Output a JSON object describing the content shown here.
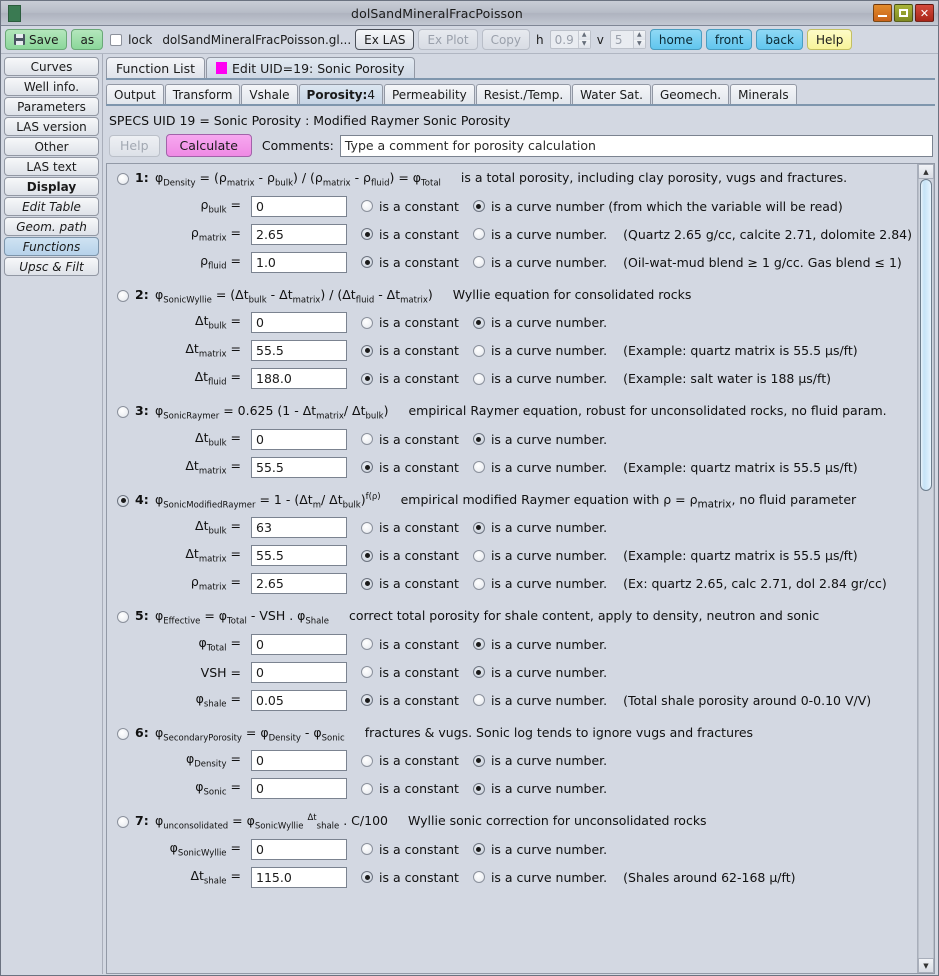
{
  "window": {
    "title": "dolSandMineralFracPoisson",
    "buttons": {
      "minimize": "–",
      "maximize": "□",
      "close": "✕"
    }
  },
  "toolbar": {
    "save_label": "Save",
    "save_as_label": "as",
    "lock_label": "lock",
    "filename": "dolSandMineralFracPoisson.gl...",
    "ex_las_label": "Ex LAS",
    "ex_plot_label": "Ex Plot",
    "copy_label": "Copy",
    "h_label": "h",
    "h_value": "0.9",
    "v_label": "v",
    "v_value": "5",
    "home_label": "home",
    "front_label": "front",
    "back_label": "back",
    "help_label": "Help"
  },
  "sidebar": {
    "items": [
      {
        "label": "Curves",
        "style": "normal",
        "selected": false
      },
      {
        "label": "Well info.",
        "style": "normal",
        "selected": false
      },
      {
        "label": "Parameters",
        "style": "normal",
        "selected": false
      },
      {
        "label": "LAS version",
        "style": "normal",
        "selected": false
      },
      {
        "label": "Other",
        "style": "normal",
        "selected": false
      },
      {
        "label": "LAS text",
        "style": "normal",
        "selected": false
      },
      {
        "label": "Display",
        "style": "bold",
        "selected": false
      },
      {
        "label": "Edit Table",
        "style": "italic",
        "selected": false
      },
      {
        "label": "Geom. path",
        "style": "italic",
        "selected": false
      },
      {
        "label": "Functions",
        "style": "italic",
        "selected": true
      },
      {
        "label": "Upsc & Filt",
        "style": "italic",
        "selected": false
      }
    ]
  },
  "tabs_primary": [
    {
      "label": "Function List",
      "active": false,
      "has_marker": false
    },
    {
      "label": "Edit UID=19: Sonic Porosity",
      "active": true,
      "has_marker": true
    }
  ],
  "tabs_secondary": [
    {
      "label": "Output",
      "suffix": "",
      "active": false
    },
    {
      "label": "Transform",
      "suffix": "",
      "active": false
    },
    {
      "label": "Vshale",
      "suffix": "",
      "active": false
    },
    {
      "label": "Porosity:",
      "suffix": "4",
      "active": true
    },
    {
      "label": "Permeability",
      "suffix": "",
      "active": false
    },
    {
      "label": "Resist./Temp.",
      "suffix": "",
      "active": false
    },
    {
      "label": "Water Sat.",
      "suffix": "",
      "active": false
    },
    {
      "label": "Geomech.",
      "suffix": "",
      "active": false
    },
    {
      "label": "Minerals",
      "suffix": "",
      "active": false
    }
  ],
  "specs_line": "SPECS UID 19 = Sonic Porosity : Modified Raymer Sonic Porosity",
  "actions": {
    "help_label": "Help",
    "calculate_label": "Calculate",
    "comments_label": "Comments:",
    "comments_value": "Type a comment for porosity calculation"
  },
  "option_labels": {
    "constant": "is a constant",
    "curve": "is a curve number.",
    "curve_long": "is a curve number (from which the variable will be read)"
  },
  "colors": {
    "accent_tab": "#ff00f2",
    "calculate_button": "#f29ae8",
    "nav_button": "#6ec9ee",
    "save_button": "#8bd79a",
    "help_button": "#f7f39a"
  },
  "blocks": [
    {
      "num": "1:",
      "selected": false,
      "formula_html": "φ<sub>Density</sub> = (ρ<sub>matrix</sub> - ρ<sub>bulk</sub>) / (ρ<sub>matrix</sub> - ρ<sub>fluid</sub>) = φ<sub>Total</sub>",
      "desc": "is a total porosity, including clay porosity, vugs and fractures.",
      "rows": [
        {
          "label_html": "ρ<sub>bulk</sub> =",
          "value": "0",
          "mode": "curve",
          "curve_text_long": true,
          "hint": ""
        },
        {
          "label_html": "ρ<sub>matrix</sub> =",
          "value": "2.65",
          "mode": "constant",
          "curve_text_long": false,
          "hint": "(Quartz 2.65 g/cc, calcite 2.71, dolomite 2.84)"
        },
        {
          "label_html": "ρ<sub>fluid</sub> =",
          "value": "1.0",
          "mode": "constant",
          "curve_text_long": false,
          "hint": "(Oil-wat-mud blend ≥ 1 g/cc. Gas blend ≤ 1)"
        }
      ]
    },
    {
      "num": "2:",
      "selected": false,
      "formula_html": "φ<sub>SonicWyllie</sub> = (Δt<sub>bulk</sub> - Δt<sub>matrix</sub>) / (Δt<sub>fluid</sub> - Δt<sub>matrix</sub>)",
      "desc": "Wyllie equation for consolidated rocks",
      "rows": [
        {
          "label_html": "Δt<sub>bulk</sub> =",
          "value": "0",
          "mode": "curve",
          "curve_text_long": false,
          "hint": ""
        },
        {
          "label_html": "Δt<sub>matrix</sub> =",
          "value": "55.5",
          "mode": "constant",
          "curve_text_long": false,
          "hint": "(Example: quartz matrix is 55.5 µs/ft)"
        },
        {
          "label_html": "Δt<sub>fluid</sub> =",
          "value": "188.0",
          "mode": "constant",
          "curve_text_long": false,
          "hint": "(Example: salt water is 188 µs/ft)"
        }
      ]
    },
    {
      "num": "3:",
      "selected": false,
      "formula_html": "φ<sub>SonicRaymer</sub> = 0.625 (1 - Δt<sub>matrix</sub>/ Δt<sub>bulk</sub>)",
      "desc": "empirical Raymer equation, robust for unconsolidated rocks, no fluid param.",
      "rows": [
        {
          "label_html": "Δt<sub>bulk</sub> =",
          "value": "0",
          "mode": "curve",
          "curve_text_long": false,
          "hint": ""
        },
        {
          "label_html": "Δt<sub>matrix</sub> =",
          "value": "55.5",
          "mode": "constant",
          "curve_text_long": false,
          "hint": "(Example: quartz matrix is 55.5 µs/ft)"
        }
      ]
    },
    {
      "num": "4:",
      "selected": true,
      "formula_html": "φ<sub>SonicModifiedRaymer</sub> = 1 - (Δt<sub>m</sub>/ Δt<sub>bulk</sub>)<sup>f(ρ)</sup>",
      "desc": "empirical modified Raymer equation with ρ = ρ<sub>matrix</sub>, no fluid parameter",
      "rows": [
        {
          "label_html": "Δt<sub>bulk</sub> =",
          "value": "63",
          "mode": "curve",
          "curve_text_long": false,
          "hint": ""
        },
        {
          "label_html": "Δt<sub>matrix</sub> =",
          "value": "55.5",
          "mode": "constant",
          "curve_text_long": false,
          "hint": "(Example: quartz matrix is 55.5 µs/ft)"
        },
        {
          "label_html": "ρ<sub>matrix</sub> =",
          "value": "2.65",
          "mode": "constant",
          "curve_text_long": false,
          "hint": "(Ex: quartz 2.65, calc 2.71, dol 2.84 gr/cc)"
        }
      ]
    },
    {
      "num": "5:",
      "selected": false,
      "formula_html": "φ<sub>Effective</sub> = φ<sub>Total</sub> - VSH . φ<sub>Shale</sub>",
      "desc": "correct total porosity for shale content, apply to density, neutron and sonic",
      "rows": [
        {
          "label_html": "φ<sub>Total</sub> =",
          "value": "0",
          "mode": "curve",
          "curve_text_long": false,
          "hint": ""
        },
        {
          "label_html": "VSH =",
          "value": "0",
          "mode": "curve",
          "curve_text_long": false,
          "hint": ""
        },
        {
          "label_html": "φ<sub>shale</sub> =",
          "value": "0.05",
          "mode": "constant",
          "curve_text_long": false,
          "hint": "(Total shale porosity around 0-0.10 V/V)"
        }
      ]
    },
    {
      "num": "6:",
      "selected": false,
      "formula_html": "φ<sub>SecondaryPorosity</sub> = φ<sub>Density</sub> - φ<sub>Sonic</sub>",
      "desc": "fractures & vugs. Sonic log tends to ignore vugs and fractures",
      "rows": [
        {
          "label_html": "φ<sub>Density</sub> =",
          "value": "0",
          "mode": "curve",
          "curve_text_long": false,
          "hint": ""
        },
        {
          "label_html": "φ<sub>Sonic</sub> =",
          "value": "0",
          "mode": "curve",
          "curve_text_long": false,
          "hint": ""
        }
      ]
    },
    {
      "num": "7:",
      "selected": false,
      "formula_html": "φ<sub>unconsolidated</sub> = φ<sub>SonicWyllie</sub> <sup>Δt</sup><sub>shale</sub> . C/100",
      "desc": "Wyllie sonic correction for unconsolidated rocks",
      "rows": [
        {
          "label_html": "φ<sub>SonicWyllie</sub> =",
          "value": "0",
          "mode": "curve",
          "curve_text_long": false,
          "hint": ""
        },
        {
          "label_html": "Δt<sub>shale</sub> =",
          "value": "115.0",
          "mode": "constant",
          "curve_text_long": false,
          "hint": "(Shales around 62-168 µ/ft)"
        }
      ]
    }
  ],
  "scrollbar": {
    "thumb_top_pct": 0,
    "thumb_height_pct": 40,
    "up_arrow": "▲",
    "down_arrow": "▼"
  }
}
